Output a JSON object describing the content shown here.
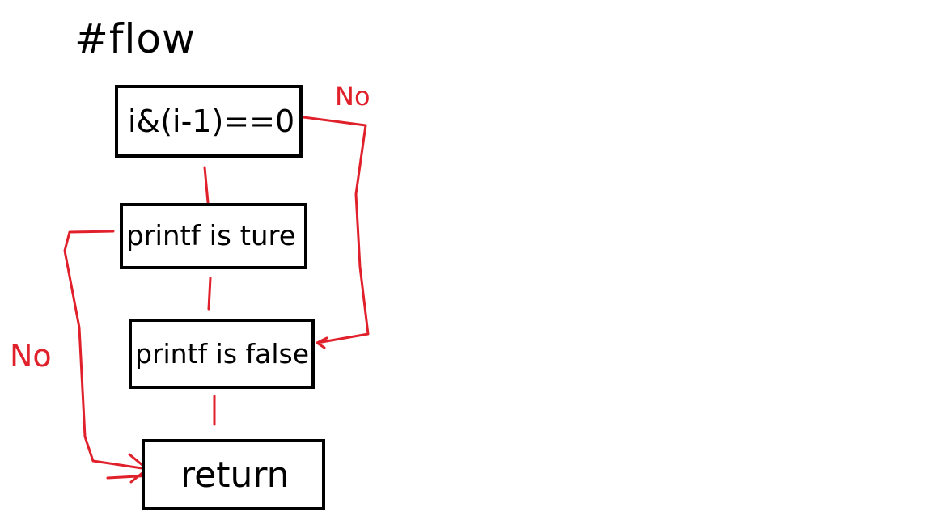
{
  "diagram": {
    "title": "#flow",
    "nodes": {
      "condition": "i&(i-1)==0",
      "true_branch": "printf is ture",
      "false_branch": "printf is false",
      "end": "return"
    },
    "edge_labels": {
      "condition_no": "No",
      "true_no": "No"
    },
    "colors": {
      "ink": "#000000",
      "edge": "#e0202a",
      "background": "#ffffff"
    }
  }
}
